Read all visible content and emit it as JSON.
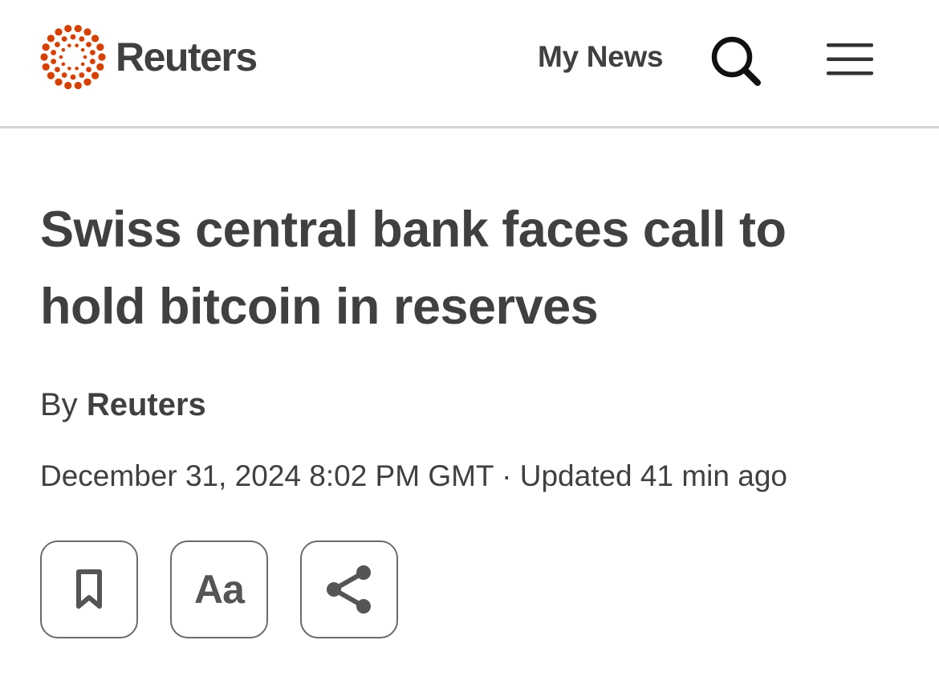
{
  "header": {
    "logo_text": "Reuters",
    "my_news_label": "My News",
    "search_icon": "search-icon",
    "menu_icon": "hamburger-menu-icon",
    "brand_color": "#d64000"
  },
  "article": {
    "headline": "Swiss central bank faces call to hold bitcoin in reserves",
    "byline_prefix": "By",
    "author": "Reuters",
    "dateline": "December 31, 2024 8:02 PM GMT · Updated 41 min ago"
  },
  "actions": {
    "bookmark_icon": "bookmark-icon",
    "text_size_label": "Aa",
    "share_icon": "share-icon"
  }
}
